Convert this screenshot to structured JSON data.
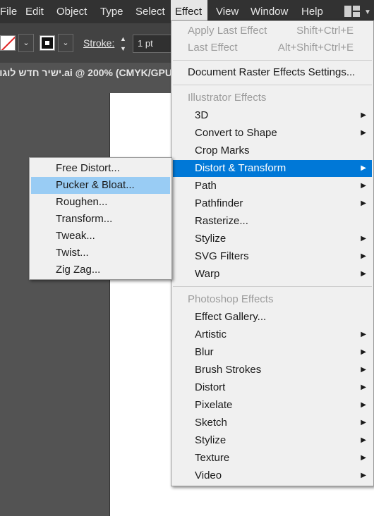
{
  "menubar": {
    "items": [
      "File",
      "Edit",
      "Object",
      "Type",
      "Select",
      "Effect",
      "View",
      "Window",
      "Help"
    ],
    "active": "Effect"
  },
  "controlbar": {
    "stroke_label": "Stroke:",
    "stroke_weight": "1 pt"
  },
  "document": {
    "tab_title": "ישיר חדש לוגו.ai @ 200% (CMYK/GPU"
  },
  "effect_menu": {
    "apply_last": {
      "label": "Apply Last Effect",
      "shortcut": "Shift+Ctrl+E"
    },
    "last_effect": {
      "label": "Last Effect",
      "shortcut": "Alt+Shift+Ctrl+E"
    },
    "raster_settings": "Document Raster Effects Settings...",
    "illustrator_header": "Illustrator Effects",
    "illustrator_items": [
      "3D",
      "Convert to Shape",
      "Crop Marks",
      "Distort & Transform",
      "Path",
      "Pathfinder",
      "Rasterize...",
      "Stylize",
      "SVG Filters",
      "Warp"
    ],
    "photoshop_header": "Photoshop Effects",
    "photoshop_items": [
      "Effect Gallery...",
      "Artistic",
      "Blur",
      "Brush Strokes",
      "Distort",
      "Pixelate",
      "Sketch",
      "Stylize",
      "Texture",
      "Video"
    ],
    "highlighted": "Distort & Transform"
  },
  "distort_submenu": {
    "items": [
      "Free Distort...",
      "Pucker & Bloat...",
      "Roughen...",
      "Transform...",
      "Tweak...",
      "Twist...",
      "Zig Zag..."
    ],
    "highlighted": "Pucker & Bloat..."
  },
  "colors": {
    "menubar_bg": "#323232",
    "menu_bg": "#f0f0f0",
    "highlight": "#0078d7",
    "submenu_hover": "#99ccf4"
  }
}
